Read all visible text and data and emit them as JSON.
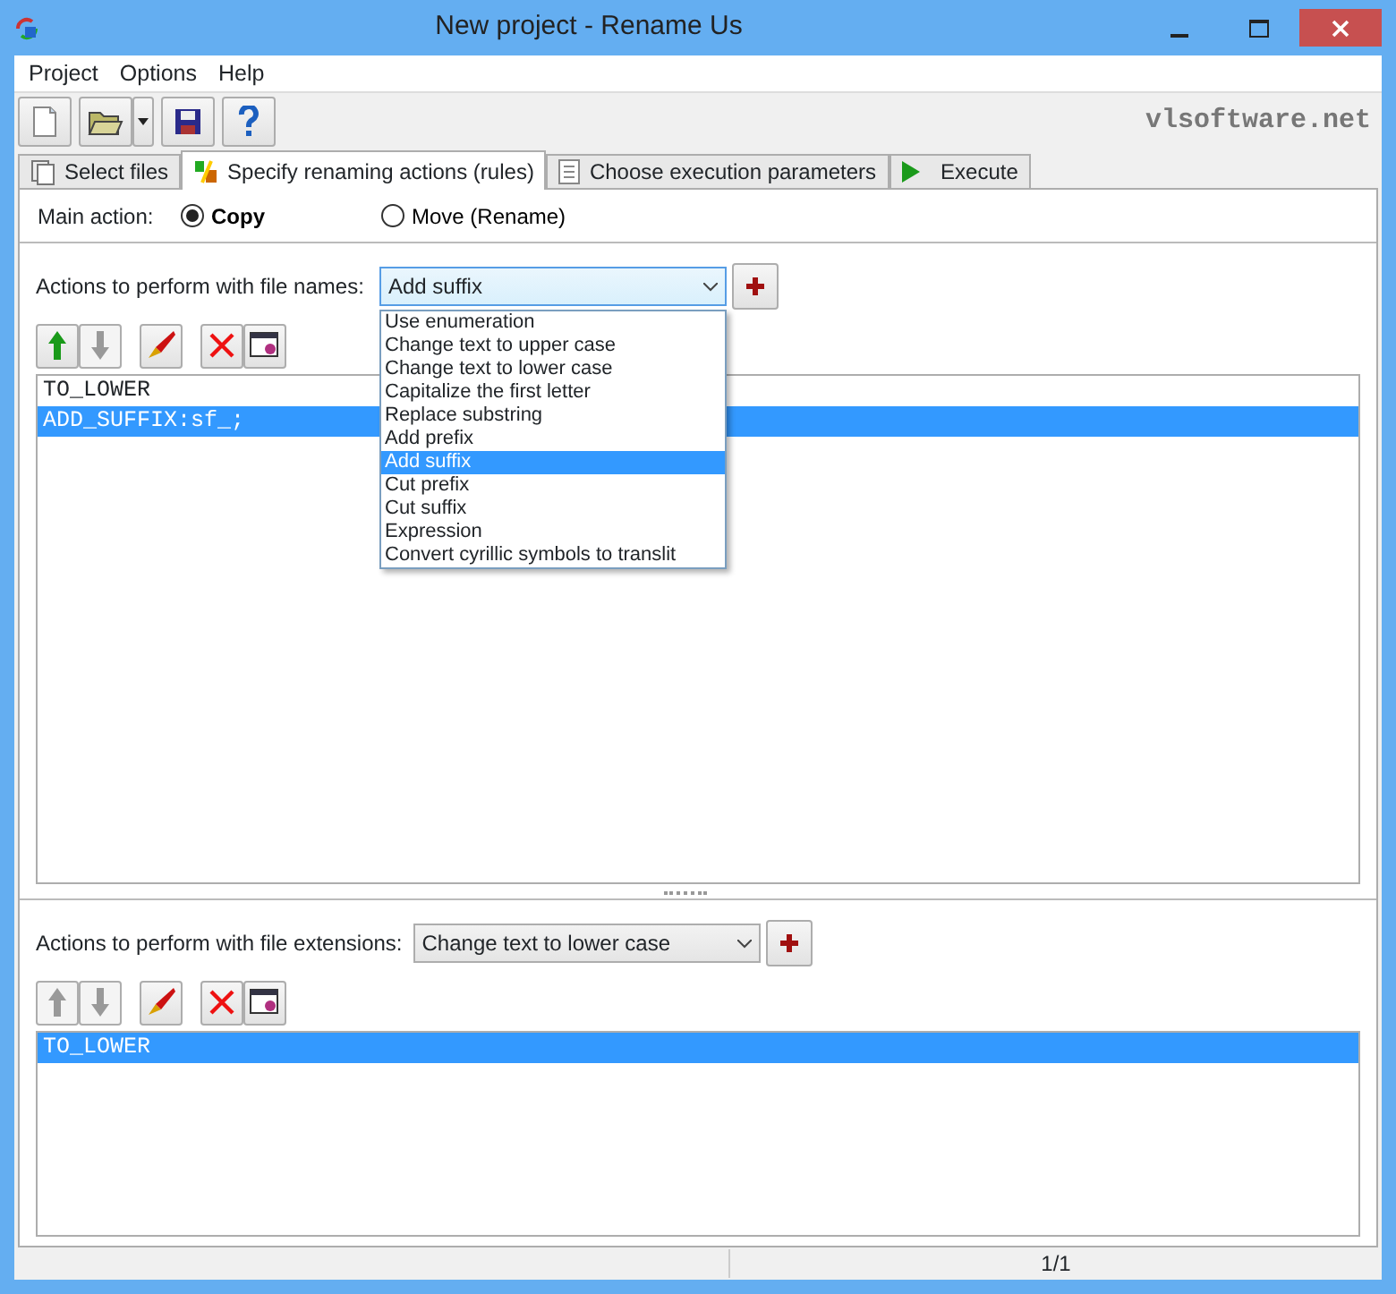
{
  "window": {
    "title": "New project - Rename Us"
  },
  "menu": [
    "Project",
    "Options",
    "Help"
  ],
  "toolbar": {
    "buttons": [
      {
        "kind": "new"
      },
      {
        "kind": "open"
      },
      {
        "kind": "save"
      },
      {
        "kind": "help"
      }
    ],
    "site": "vlsoftware.net"
  },
  "tabs": [
    {
      "label": "Select files",
      "kind": "files",
      "selected": false
    },
    {
      "label": "Specify renaming actions (rules)",
      "kind": "rules",
      "selected": true
    },
    {
      "label": "Choose execution parameters",
      "kind": "params",
      "selected": false
    },
    {
      "label": "Execute",
      "kind": "execute",
      "selected": false
    }
  ],
  "main_action": {
    "label": "Main action:",
    "options": [
      {
        "label": "Copy",
        "selected": true
      },
      {
        "label": "Move (Rename)",
        "selected": false
      }
    ]
  },
  "name_actions": {
    "label": "Actions to perform with file names:",
    "value": "Add suffix",
    "expanded": true,
    "options": [
      {
        "label": "Use enumeration",
        "selected": false
      },
      {
        "label": "Change text to upper case",
        "selected": false
      },
      {
        "label": "Change text to lower case",
        "selected": false
      },
      {
        "label": "Capitalize the first letter",
        "selected": false
      },
      {
        "label": "Replace substring",
        "selected": false
      },
      {
        "label": "Add prefix",
        "selected": false
      },
      {
        "label": "Add suffix",
        "selected": true
      },
      {
        "label": "Cut prefix",
        "selected": false
      },
      {
        "label": "Cut suffix",
        "selected": false
      },
      {
        "label": "Expression",
        "selected": false
      },
      {
        "label": "Convert cyrillic symbols to translit",
        "selected": false
      }
    ],
    "buttons": [
      {
        "kind": "up",
        "disabled": false
      },
      {
        "kind": "down",
        "disabled": true
      },
      {
        "kind": "edit"
      },
      {
        "kind": "delete"
      },
      {
        "kind": "properties"
      }
    ],
    "rules": [
      {
        "text": "TO_LOWER",
        "selected": false
      },
      {
        "text": "ADD_SUFFIX:sf_;",
        "selected": true
      }
    ]
  },
  "ext_actions": {
    "label": "Actions to perform with file extensions:",
    "value": "Change text to lower case",
    "expanded": false,
    "buttons": [
      {
        "kind": "up",
        "disabled": true
      },
      {
        "kind": "down",
        "disabled": true
      },
      {
        "kind": "edit"
      },
      {
        "kind": "delete"
      },
      {
        "kind": "properties"
      }
    ],
    "rules": [
      {
        "text": "TO_LOWER",
        "selected": true
      }
    ]
  },
  "status_bar": {
    "page": "1/1"
  }
}
